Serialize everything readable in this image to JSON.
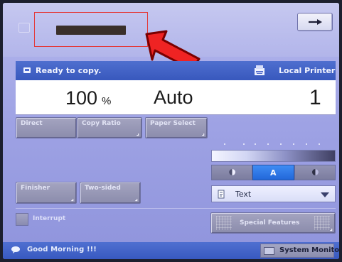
{
  "top": {
    "arrow_button": "→"
  },
  "status": {
    "message": "Ready to copy.",
    "printer_label": "Local Printer"
  },
  "display": {
    "ratio_value": "100",
    "ratio_unit": "%",
    "paper_value": "Auto",
    "copies_value": "1"
  },
  "buttons": {
    "direct": "Direct",
    "copy_ratio": "Copy Ratio",
    "paper_select": "Paper Select",
    "finisher": "Finisher",
    "two_sided": "Two-sided",
    "interrupt": "Interrupt",
    "special_features": "Special Features"
  },
  "density": {
    "auto_label": "A"
  },
  "image_mode": {
    "selected": "Text"
  },
  "bottom": {
    "message": "Good Morning !!!",
    "system_monitor": "System Monitor"
  }
}
